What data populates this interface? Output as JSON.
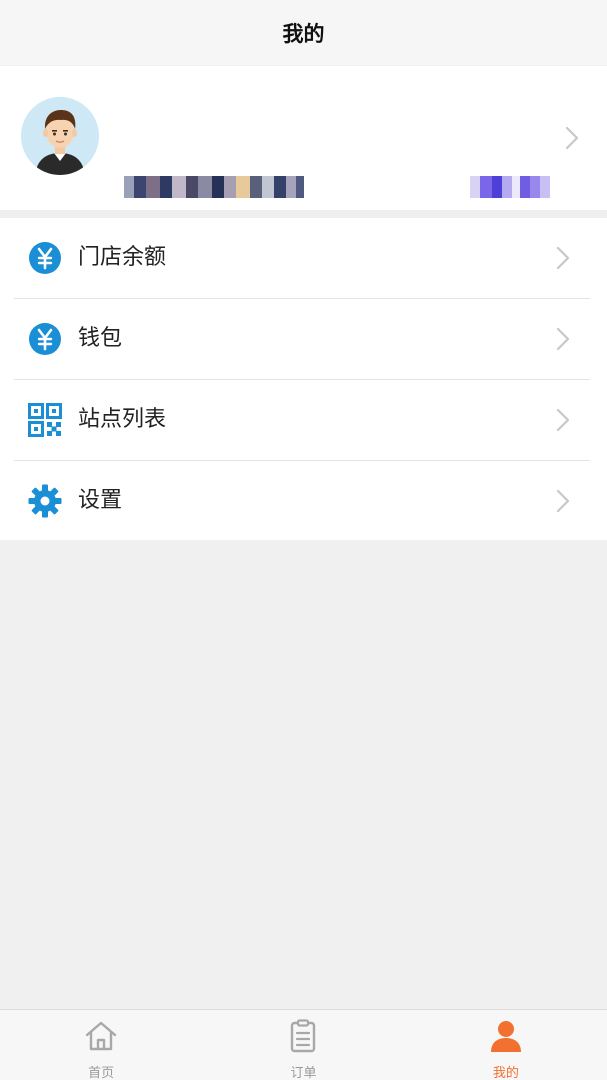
{
  "header": {
    "title": "我的"
  },
  "profile": {
    "avatar_icon": "user-avatar-icon",
    "name_redacted": true,
    "subtitle_redacted": true,
    "right_info_redacted": true
  },
  "menu": {
    "items": [
      {
        "id": "store-balance",
        "label": "门店余额",
        "icon": "yuan-icon"
      },
      {
        "id": "wallet",
        "label": "钱包",
        "icon": "yuan-icon"
      },
      {
        "id": "site-list",
        "label": "站点列表",
        "icon": "qr-code-icon"
      },
      {
        "id": "settings",
        "label": "设置",
        "icon": "gear-icon"
      }
    ]
  },
  "tabbar": {
    "tabs": [
      {
        "id": "home",
        "label": "首页",
        "icon": "home-icon",
        "active": false
      },
      {
        "id": "orders",
        "label": "订单",
        "icon": "clipboard-icon",
        "active": false
      },
      {
        "id": "mine",
        "label": "我的",
        "icon": "person-icon",
        "active": true
      }
    ]
  },
  "colors": {
    "accent": "#1a8fd6",
    "active_tab": "#f27130",
    "inactive_tab": "#9a9a9a"
  }
}
